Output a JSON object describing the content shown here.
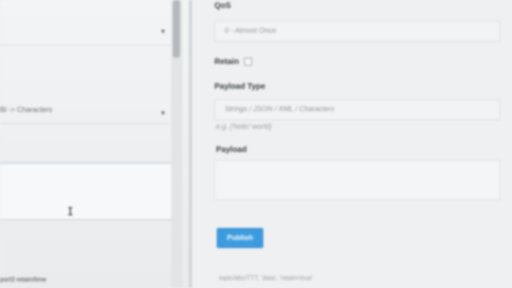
{
  "left": {
    "rows": [
      {
        "label": ""
      },
      {
        "label": "Bl -> Characters"
      }
    ],
    "footer": "port3 retain/time"
  },
  "form": {
    "qos_label": "QoS",
    "qos_value": "0 - Almost Once",
    "retain_label": "Retain",
    "payload_type_label": "Payload Type",
    "payload_type_value": "Strings / JSON / XML / Characters",
    "payload_type_hint": "e.g. ['hello' world]",
    "payload_label": "Payload",
    "payload_value": "",
    "publish_label": "Publish",
    "footer": "topic/abc/TTT, 'data', 'retain=true'"
  },
  "colors": {
    "accent": "#3d9be0",
    "background": "#eef0f1"
  }
}
